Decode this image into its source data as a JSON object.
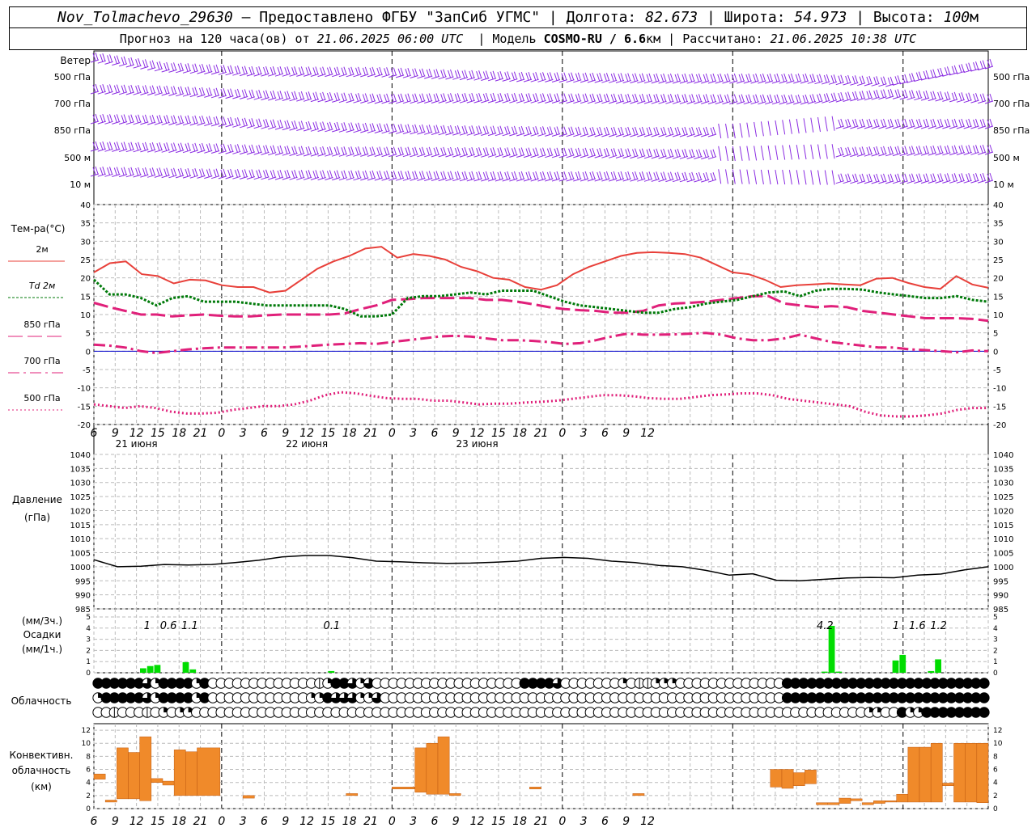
{
  "header": {
    "station": "Nov_Tolmachevo_29630",
    "provider": " – Предоставлено ФГБУ \"ЗапСиб УГМС\" | Долгота: ",
    "lon": "82.673",
    "lat_label": " | Широта: ",
    "lat": "54.973",
    "alt_label": " | Высота: ",
    "alt": "100",
    "alt_unit": "м",
    "fc_prefix": "Прогноз на 120 часа(ов) от ",
    "fc_time": "21.06.2025 06:00 UTC",
    "model_label": "  | Модель ",
    "model": "COSMO-RU / 6.6",
    "model_unit": "км",
    "calc_label": " | Рассчитано: ",
    "calc_time": "21.06.2025 10:38 UTC"
  },
  "labels": {
    "wind": "Ветер",
    "temp": "Тем-ра(°С)",
    "pressure": "Давление",
    "pressure_unit": "(гПа)",
    "precip_top": "(мм/3ч.)",
    "precip": "Осадки",
    "precip_bottom": "(мм/1ч.)",
    "cloud": "Облачность",
    "conv1": "Конвективн.",
    "conv2": "облачность",
    "conv3": "(км)"
  },
  "colors": {
    "t2m": "#e8403a",
    "td": "#007a0a",
    "iso850": "#e0207a",
    "iso700": "#e0207a",
    "iso500": "#e0207a",
    "wind": "#8a2be2",
    "precip": "#00dd00",
    "conv": "#f08a2a",
    "zero": "#0000cc"
  },
  "chart_data": {
    "time_ticks": [
      "6",
      "9",
      "12",
      "15",
      "18",
      "21",
      "0",
      "3",
      "6",
      "9",
      "12",
      "15",
      "18",
      "21",
      "0",
      "3",
      "6",
      "9",
      "12",
      "15",
      "18",
      "21",
      "0",
      "3",
      "6",
      "9",
      "12"
    ],
    "dates": [
      "21 июня",
      "22 июня",
      "23 июня"
    ],
    "wind": {
      "levels": [
        "500 гПа",
        "700 гПа",
        "850 гПа",
        "500 м",
        "10 м"
      ]
    },
    "temperature": {
      "ylim": [
        -20,
        40
      ],
      "ticks": [
        "40",
        "35",
        "30",
        "25",
        "20",
        "15",
        "10",
        "5",
        "0",
        "-5",
        "-10",
        "-15",
        "-20"
      ],
      "legend": [
        {
          "label": "2м",
          "style": "t2m"
        },
        {
          "label": "Td 2м",
          "style": "td"
        },
        {
          "label": "850 гПа",
          "style": "iso850"
        },
        {
          "label": "700 гПа",
          "style": "iso700"
        },
        {
          "label": "500 гПа",
          "style": "iso500"
        }
      ],
      "t2m": [
        21.5,
        24,
        24.5,
        21,
        20.5,
        18.5,
        19.5,
        19.3,
        18,
        17.5,
        17.5,
        16,
        16.5,
        19.5,
        22.5,
        24.5,
        26,
        28,
        28.5,
        25.5,
        26.5,
        26,
        25,
        23,
        21.8,
        20,
        19.5,
        17.5,
        16.8,
        18,
        21,
        23,
        24.5,
        26,
        26.8,
        27,
        26.8,
        26.5,
        25.5,
        23.5,
        21.5,
        21,
        19.5,
        17.5,
        18,
        18.2,
        18.5,
        18.2,
        18,
        19.8,
        20,
        18.6,
        17.5,
        17,
        20.5,
        18.2,
        17.3
      ],
      "td": [
        19.5,
        15.5,
        15.5,
        14.5,
        12.5,
        14.5,
        15,
        13.5,
        13.5,
        13.5,
        13,
        12.5,
        12.5,
        12.5,
        12.5,
        12.5,
        11.5,
        9.5,
        9.5,
        10,
        14.5,
        15,
        15,
        15.5,
        16,
        15.5,
        16.5,
        16.5,
        16.5,
        15,
        13.5,
        12.5,
        12,
        11.5,
        11,
        10.5,
        10.5,
        11.5,
        12,
        13,
        13.5,
        14,
        15,
        16,
        16.3,
        15,
        16.5,
        17,
        17,
        16.8,
        16,
        15.5,
        15,
        14.5,
        14.5,
        15,
        14,
        13.5
      ],
      "t850": [
        13.2,
        12,
        11,
        10,
        10,
        9.5,
        9.8,
        10,
        9.7,
        9.5,
        9.5,
        9.8,
        10,
        10,
        10,
        10,
        10.3,
        11.5,
        12.5,
        14,
        14.2,
        14.5,
        14.5,
        14.5,
        14.5,
        14,
        14,
        13.5,
        12.8,
        12,
        11.5,
        11.2,
        11,
        10.5,
        10.5,
        11,
        12.5,
        13,
        13.2,
        13.5,
        14,
        14.5,
        15,
        15,
        13,
        12.5,
        12,
        12.3,
        12,
        11,
        10.5,
        10,
        9.5,
        9,
        9,
        9,
        8.8,
        8.3
      ],
      "t700": [
        1.8,
        1.5,
        1,
        0,
        -0.5,
        0,
        0.5,
        0.8,
        1,
        1,
        1,
        1,
        1,
        1.2,
        1.5,
        1.8,
        2,
        2.2,
        2,
        2.5,
        3,
        3.5,
        4,
        4.2,
        4,
        3.5,
        3,
        3,
        2.8,
        2.5,
        2,
        2.2,
        3,
        4,
        4.8,
        4.5,
        4.5,
        4.6,
        4.8,
        5,
        4.5,
        3.5,
        3,
        3,
        3.5,
        4.5,
        3.5,
        2.5,
        2,
        1.5,
        1,
        1,
        0.5,
        0.3,
        0,
        -0.3,
        0.2,
        0
      ],
      "t500": [
        -14.5,
        -15,
        -15.5,
        -15,
        -15.5,
        -16.5,
        -17,
        -17,
        -16.8,
        -16,
        -15.5,
        -15,
        -15,
        -14.5,
        -13.5,
        -12,
        -11.2,
        -11.5,
        -12.2,
        -12.8,
        -13,
        -13,
        -13.5,
        -13.5,
        -14,
        -14.5,
        -14.3,
        -14.3,
        -14,
        -13.8,
        -13.5,
        -13,
        -12.5,
        -12,
        -12,
        -12.3,
        -12.8,
        -13,
        -13,
        -12.5,
        -12,
        -11.8,
        -11.5,
        -11.5,
        -12,
        -13,
        -13.5,
        -14,
        -14.5,
        -15,
        -16.5,
        -17.5,
        -17.8,
        -17.8,
        -17.5,
        -17,
        -16,
        -15.5,
        -15.5
      ]
    },
    "pressure": {
      "ylim": [
        985,
        1040
      ],
      "ticks": [
        "1040",
        "1035",
        "1030",
        "1025",
        "1020",
        "1015",
        "1010",
        "1005",
        "1000",
        "995",
        "990",
        "985"
      ],
      "values": [
        1002.5,
        1000,
        1000.2,
        1000.8,
        1000.6,
        1000.8,
        1001.5,
        1002.3,
        1003.5,
        1004,
        1004,
        1003.2,
        1002,
        1001.8,
        1001.4,
        1001.2,
        1001.3,
        1001.6,
        1002,
        1003,
        1003.3,
        1003,
        1002,
        1001.5,
        1000.5,
        1000,
        998.7,
        997,
        997.5,
        995.2,
        995,
        995.5,
        996,
        996.2,
        996.1,
        997,
        997.4,
        998.9,
        1000
      ]
    },
    "precipitation": {
      "ylim": [
        0,
        5
      ],
      "ticks": [
        "5",
        "4",
        "3",
        "2",
        "1",
        "0"
      ],
      "totals": [
        {
          "label": "1",
          "h": 7.5
        },
        {
          "label": "0.6",
          "h": 10.5
        },
        {
          "label": "1.1",
          "h": 13.5
        },
        {
          "label": "0.1",
          "h": 33.5
        },
        {
          "label": "4.2",
          "h": 103
        },
        {
          "label": "1",
          "h": 113
        },
        {
          "label": "1.6",
          "h": 116
        },
        {
          "label": "1.2",
          "h": 119
        }
      ],
      "hourly": [
        [
          7,
          0.4
        ],
        [
          8,
          0.6
        ],
        [
          9,
          0.7
        ],
        [
          13,
          0.95
        ],
        [
          14,
          0.3
        ],
        [
          33.5,
          0.15
        ],
        [
          103,
          0.1
        ],
        [
          104,
          4.2
        ],
        [
          105,
          0.1
        ],
        [
          113,
          1.1
        ],
        [
          114,
          1.6
        ],
        [
          118,
          0.15
        ],
        [
          119,
          1.2
        ]
      ]
    },
    "cloud_rows": [
      [
        4,
        4,
        4,
        4,
        4,
        4,
        3,
        2,
        4,
        4,
        4,
        4,
        2,
        4,
        0,
        0,
        0,
        0,
        0,
        0,
        0,
        0,
        0,
        0,
        0,
        0,
        0,
        1,
        2,
        4,
        4,
        3,
        2,
        3,
        0,
        0,
        0,
        0,
        0,
        0,
        0,
        0,
        0,
        0,
        0,
        0,
        0,
        0,
        0,
        0,
        0,
        0,
        4,
        4,
        4,
        4,
        3,
        0,
        0,
        0,
        0,
        0,
        0,
        0,
        2,
        0,
        1,
        1,
        2,
        2,
        2,
        0,
        0,
        0,
        0,
        0,
        0,
        0,
        0,
        0,
        0,
        0,
        0,
        0,
        4,
        4,
        4,
        4,
        4,
        4,
        4,
        4,
        4,
        4,
        4,
        4,
        4,
        4,
        4,
        4,
        4,
        4,
        4,
        4,
        4,
        4,
        4,
        4,
        4
      ],
      [
        2,
        4,
        4,
        4,
        4,
        4,
        3,
        2,
        4,
        4,
        4,
        4,
        2,
        4,
        0,
        0,
        0,
        0,
        0,
        0,
        0,
        0,
        0,
        0,
        0,
        0,
        2,
        2,
        4,
        3,
        3,
        3,
        2,
        2,
        3,
        0,
        0,
        0,
        0,
        0,
        0,
        0,
        0,
        0,
        0,
        0,
        0,
        0,
        0,
        0,
        0,
        0,
        0,
        0,
        0,
        0,
        0,
        0,
        0,
        0,
        0,
        0,
        0,
        0,
        0,
        0,
        0,
        0,
        0,
        0,
        0,
        0,
        0,
        0,
        0,
        0,
        0,
        0,
        0,
        0,
        0,
        0,
        0,
        0,
        4,
        4,
        4,
        4,
        4,
        4,
        4,
        4,
        4,
        4,
        4,
        4,
        4,
        4,
        4,
        4,
        4,
        4,
        4,
        4,
        4,
        4,
        4,
        4,
        4
      ],
      [
        0,
        0,
        1,
        0,
        0,
        0,
        1,
        0,
        2,
        0,
        2,
        2,
        0,
        0,
        0,
        0,
        0,
        0,
        0,
        0,
        0,
        0,
        0,
        0,
        0,
        0,
        0,
        0,
        0,
        0,
        0,
        0,
        0,
        0,
        0,
        0,
        0,
        0,
        0,
        0,
        0,
        0,
        0,
        0,
        0,
        0,
        0,
        0,
        0,
        0,
        0,
        0,
        0,
        0,
        0,
        0,
        0,
        0,
        0,
        0,
        0,
        0,
        0,
        0,
        0,
        0,
        0,
        0,
        0,
        0,
        0,
        0,
        0,
        0,
        0,
        0,
        0,
        0,
        0,
        0,
        0,
        0,
        0,
        0,
        0,
        0,
        0,
        0,
        0,
        0,
        0,
        0,
        0,
        0,
        2,
        2,
        0,
        0,
        4,
        2,
        2,
        4,
        4,
        4,
        4,
        4,
        4,
        4,
        4
      ]
    ],
    "convective": {
      "ylim": [
        0,
        13
      ],
      "ticks": [
        "12",
        "10",
        "8",
        "6",
        "4",
        "2",
        "0"
      ],
      "bars": [
        [
          0,
          1,
          4.5,
          5.3
        ],
        [
          1,
          2,
          1,
          1.3
        ],
        [
          2,
          3,
          1.5,
          9.3
        ],
        [
          3,
          4,
          1.5,
          8.6
        ],
        [
          4,
          5,
          1.2,
          11
        ],
        [
          5,
          6,
          4,
          4.6
        ],
        [
          6,
          7,
          3.6,
          4.2
        ],
        [
          7,
          8,
          2,
          9
        ],
        [
          8,
          9,
          2,
          8.7
        ],
        [
          9,
          11,
          2,
          9.3
        ],
        [
          13,
          14,
          1.6,
          2
        ],
        [
          22,
          23,
          2,
          2.3
        ],
        [
          26,
          28,
          3,
          3.3
        ],
        [
          28,
          29,
          2.5,
          9.3
        ],
        [
          29,
          30,
          2.2,
          10
        ],
        [
          30,
          31,
          2.2,
          11
        ],
        [
          31,
          32,
          2,
          2.3
        ],
        [
          38,
          39,
          3,
          3.3
        ],
        [
          47,
          48,
          2,
          2.3
        ],
        [
          59,
          60,
          3.3,
          6
        ],
        [
          60,
          61,
          3.1,
          6
        ],
        [
          61,
          62,
          3.5,
          5.5
        ],
        [
          62,
          63,
          3.8,
          5.9
        ],
        [
          63,
          64,
          0.6,
          0.9
        ],
        [
          64,
          65,
          0.6,
          0.9
        ],
        [
          65,
          66,
          0.8,
          1.6
        ],
        [
          66,
          67,
          1.2,
          1.5
        ],
        [
          67,
          68,
          0.6,
          0.9
        ],
        [
          68,
          69,
          0.8,
          1.2
        ],
        [
          69,
          70,
          1,
          1.2
        ],
        [
          70,
          71,
          1,
          2.2
        ],
        [
          71,
          72,
          1,
          9.4
        ],
        [
          72,
          73,
          1,
          9.4
        ],
        [
          73,
          74,
          1,
          10
        ],
        [
          74,
          75,
          3.5,
          3.9
        ],
        [
          75,
          76,
          1,
          10
        ],
        [
          76,
          77,
          1,
          10
        ],
        [
          77,
          78,
          0.9,
          10
        ]
      ]
    }
  }
}
